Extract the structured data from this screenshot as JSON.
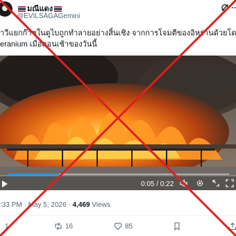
{
  "tweet": {
    "display_name": "มณีแดง",
    "handle": "@EVILSAGAGemini",
    "text_line1": "าวีแยกก๊าซในดูไบถูกทำลายอย่างสิ้นเชิง จากการโจมตีของอิหร่านด้วยโดรน",
    "text_line2": "eranium เมื่อตอนเช้าของวันนี้"
  },
  "video": {
    "time_label": "0:05 / 0:22",
    "progress": 0.23
  },
  "meta": {
    "time": ":33 PM",
    "sep1": "·",
    "date": "May 5, 2026",
    "sep2": "·",
    "views_count": "4,469",
    "views_label": "Views"
  },
  "actions": {
    "replies": "1",
    "reposts": "16",
    "likes": "85"
  },
  "overlay": {
    "stamp_color": "#e0201b"
  },
  "icons": {
    "grok": "grok-icon",
    "more": "more-icon",
    "play": "play-icon",
    "volume": "volume-icon",
    "settings": "settings-icon",
    "expand": "expand-icon",
    "fullscreen": "fullscreen-icon",
    "reply": "reply-icon",
    "repost": "repost-icon",
    "like": "heart-icon",
    "bookmark": "bookmark-icon",
    "share": "share-icon"
  }
}
